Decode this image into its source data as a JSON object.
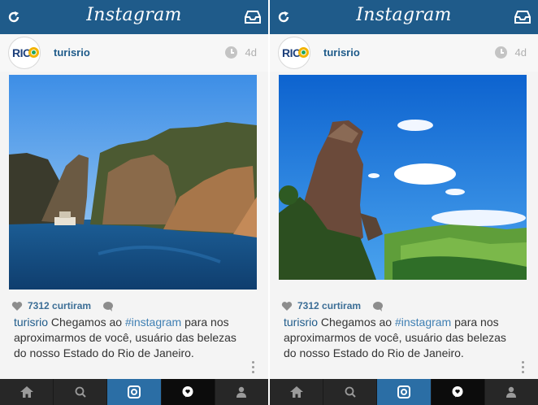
{
  "app": {
    "title": "Instagram"
  },
  "colors": {
    "topbar": "#1f5b8a",
    "link": "#1f5b8a",
    "tabbar": "#272727",
    "tab_active_camera": "#2b6ea5",
    "tab_active_news": "#0c0c0c"
  },
  "icons": {
    "refresh": "refresh-icon",
    "inbox": "inbox-icon",
    "clock": "clock-icon",
    "heart": "heart-icon",
    "comment": "comment-icon",
    "more": "more-dots-icon",
    "home": "home-icon",
    "search": "search-icon",
    "camera": "camera-icon",
    "news": "news-icon",
    "profile": "profile-icon"
  },
  "screens": [
    {
      "post": {
        "avatar_text": "RIO",
        "username": "turisrio",
        "time": "4d",
        "likes": "7312 curtiram",
        "caption": {
          "user": "turisrio",
          "before": " Chegamos ao ",
          "hashtag": "#instagram",
          "after": " para nos aproximarmos de você, usuário das belezas do nosso Estado do Rio de Janeiro."
        }
      }
    },
    {
      "post": {
        "avatar_text": "RIO",
        "username": "turisrio",
        "time": "4d",
        "likes": "7312 curtiram",
        "caption": {
          "user": "turisrio",
          "before": " Chegamos ao ",
          "hashtag": "#instagram",
          "after": " para nos aproximarmos de você, usuário das belezas do nosso Estado do Rio de Janeiro."
        }
      }
    }
  ],
  "tabs": [
    "home",
    "search",
    "camera",
    "news",
    "profile"
  ]
}
